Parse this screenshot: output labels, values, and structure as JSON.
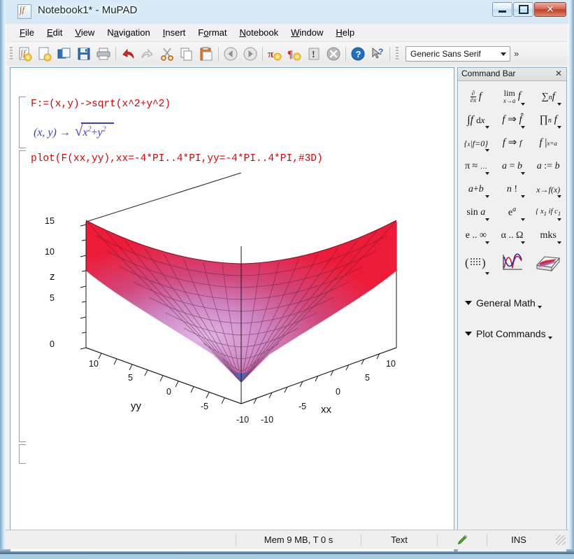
{
  "window": {
    "title": "Notebook1* - MuPAD",
    "app_icon": "mupad-notebook-icon",
    "buttons": {
      "minimize": "–",
      "maximize": "□",
      "close": "✕"
    }
  },
  "menu": [
    {
      "label": "File",
      "accel": "F"
    },
    {
      "label": "Edit",
      "accel": "E"
    },
    {
      "label": "View",
      "accel": "V"
    },
    {
      "label": "Navigation",
      "accel": "a"
    },
    {
      "label": "Insert",
      "accel": "I"
    },
    {
      "label": "Format",
      "accel": "o"
    },
    {
      "label": "Notebook",
      "accel": "N"
    },
    {
      "label": "Window",
      "accel": "W"
    },
    {
      "label": "Help",
      "accel": "H"
    }
  ],
  "toolbar": {
    "buttons": [
      {
        "name": "new-notebook-icon",
        "title": "New"
      },
      {
        "name": "new-document-icon",
        "title": "New Document"
      },
      {
        "name": "open-folder-icon",
        "title": "Open"
      },
      {
        "name": "save-icon",
        "title": "Save"
      },
      {
        "name": "print-icon",
        "title": "Print"
      },
      {
        "name": "undo-icon",
        "title": "Undo"
      },
      {
        "name": "redo-icon",
        "title": "Redo"
      },
      {
        "name": "cut-icon",
        "title": "Cut"
      },
      {
        "name": "copy-icon",
        "title": "Copy"
      },
      {
        "name": "paste-icon",
        "title": "Paste"
      },
      {
        "name": "back-arrow-icon",
        "title": "Back"
      },
      {
        "name": "forward-arrow-icon",
        "title": "Forward"
      },
      {
        "name": "evaluate-pi-icon",
        "title": "Evaluate"
      },
      {
        "name": "evaluate-all-icon",
        "title": "Evaluate All"
      },
      {
        "name": "interrupt-icon",
        "title": "Interrupt"
      },
      {
        "name": "stop-icon",
        "title": "Stop"
      },
      {
        "name": "help-icon",
        "title": "Help"
      },
      {
        "name": "context-help-icon",
        "title": "Context Help"
      }
    ],
    "font_select": {
      "value": "Generic Sans Serif",
      "placeholder": "Font"
    },
    "overflow_label": "»"
  },
  "notebook": {
    "cells": [
      {
        "type": "input",
        "text": "F:=(x,y)->sqrt(x^2+y^2)"
      },
      {
        "type": "output",
        "prefix": "(x, y) →",
        "radicand_base_x": "x",
        "radicand_exp_x": "2",
        "plus": "+",
        "radicand_base_y": "y",
        "radicand_exp_y": "2"
      },
      {
        "type": "input",
        "text": "plot(F(xx,yy),xx=-4*PI..4*PI,yy=-4*PI..4*PI,#3D)"
      },
      {
        "type": "empty-input",
        "text": ""
      }
    ]
  },
  "chart_data": {
    "type": "surface3d",
    "title": "",
    "expression": "sqrt(xx^2 + yy^2)",
    "xlabel": "xx",
    "ylabel": "yy",
    "zlabel": "z",
    "xlim": [
      -12.566,
      12.566
    ],
    "ylim": [
      -12.566,
      12.566
    ],
    "zlim": [
      0,
      17.77
    ],
    "x_ticks": [
      "-10",
      "-5",
      "0",
      "5",
      "10"
    ],
    "y_ticks": [
      "10",
      "5",
      "0",
      "-5",
      "-10"
    ],
    "z_ticks": [
      "0",
      "5",
      "10",
      "15"
    ],
    "colormap": [
      "#3a4fa8",
      "#8b5fa8",
      "#c76b9e",
      "#e8476a",
      "#ee1133"
    ],
    "grid": true,
    "mesh": true,
    "legend": "none",
    "view": "3d-perspective"
  },
  "command_bar": {
    "title": "Command Bar",
    "close_label": "✕",
    "rows": [
      [
        {
          "name": "partial-derivative-icon",
          "glyph": "∂/∂x f",
          "dropdown": false
        },
        {
          "name": "limit-icon",
          "glyph": "lim f",
          "dropdown": true
        },
        {
          "name": "sum-icon",
          "glyph": "∑ₙ f",
          "dropdown": true
        }
      ],
      [
        {
          "name": "integral-icon",
          "glyph": "∫f dx",
          "dropdown": true
        },
        {
          "name": "transform-icon",
          "glyph": "f ⇒ f̂",
          "dropdown": true
        },
        {
          "name": "product-icon",
          "glyph": "∏ₙ f",
          "dropdown": true
        }
      ],
      [
        {
          "name": "solve-icon",
          "glyph": "{x| f=0}",
          "dropdown": true
        },
        {
          "name": "simplify-icon",
          "glyph": "f ⇒ f",
          "dropdown": false
        },
        {
          "name": "substitute-icon",
          "glyph": "f |x=a",
          "dropdown": false
        }
      ],
      [
        {
          "name": "numeric-approx-icon",
          "glyph": "π ≈ …",
          "dropdown": true
        },
        {
          "name": "equation-icon",
          "glyph": "a = b",
          "dropdown": true
        },
        {
          "name": "assign-icon",
          "glyph": "a := b",
          "dropdown": false
        }
      ],
      [
        {
          "name": "addition-icon",
          "glyph": "a+b",
          "dropdown": true
        },
        {
          "name": "factorial-icon",
          "glyph": "n !",
          "dropdown": true
        },
        {
          "name": "function-map-icon",
          "glyph": "x → f(x)",
          "dropdown": true
        }
      ],
      [
        {
          "name": "trig-icon",
          "glyph": "sin a",
          "dropdown": true
        },
        {
          "name": "exponential-icon",
          "glyph": "e^a",
          "dropdown": true
        },
        {
          "name": "piecewise-icon",
          "glyph": "{x₁ if c₁",
          "dropdown": true
        }
      ],
      [
        {
          "name": "constants-icon",
          "glyph": "e .. ∞",
          "dropdown": true
        },
        {
          "name": "greek-letters-icon",
          "glyph": "α .. Ω",
          "dropdown": true
        },
        {
          "name": "units-icon",
          "glyph": "mks",
          "dropdown": true
        }
      ],
      [
        {
          "name": "matrix-icon",
          "glyph": "matrix",
          "dropdown": true
        },
        {
          "name": "plot2d-icon",
          "glyph": "plot2d",
          "dropdown": false
        },
        {
          "name": "plot3d-icon",
          "glyph": "plot3d",
          "dropdown": false
        }
      ]
    ],
    "sections": [
      {
        "name": "general-math-section",
        "label": "General Math"
      },
      {
        "name": "plot-commands-section",
        "label": "Plot Commands"
      }
    ]
  },
  "statusbar": {
    "memory": "Mem 9 MB, T 0 s",
    "mode": "Text",
    "edit_icon": "pencil-icon",
    "insert_mode": "INS"
  }
}
